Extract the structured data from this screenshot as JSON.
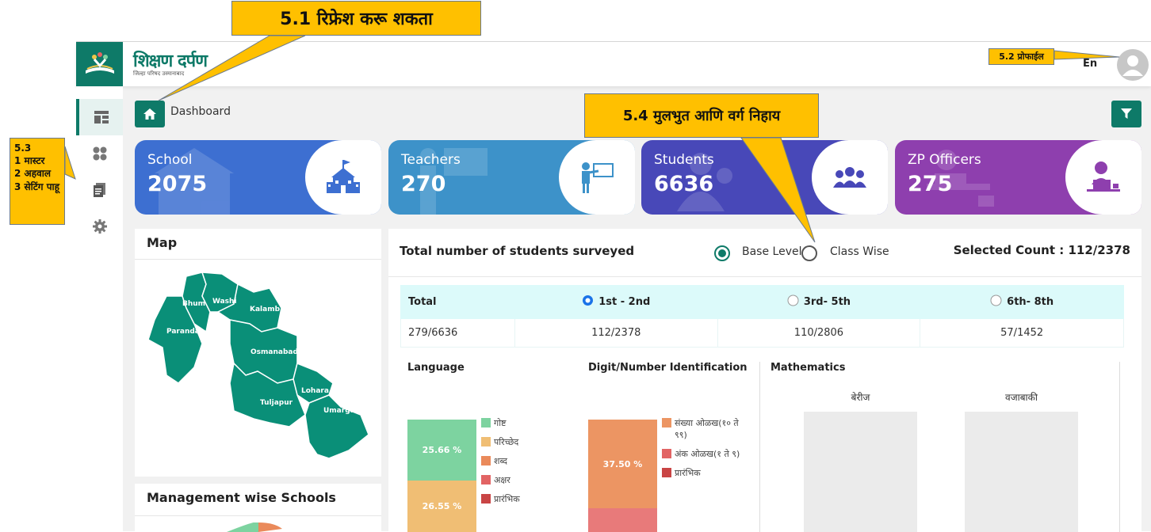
{
  "header": {
    "brand_title": "शिक्षण दर्पण",
    "brand_sub": "जिल्हा परिषद उस्मानाबाद",
    "lang": "En"
  },
  "sidebar": {
    "items": [
      {
        "icon": "dashboard-icon"
      },
      {
        "icon": "apps-icon"
      },
      {
        "icon": "report-icon"
      },
      {
        "icon": "gear-icon"
      }
    ]
  },
  "breadcrumb": {
    "label": "Dashboard"
  },
  "stats": [
    {
      "label": "School",
      "value": "2075",
      "color": "#3d6fd1",
      "icon": "school-icon"
    },
    {
      "label": "Teachers",
      "value": "270",
      "color": "#3d92c9",
      "icon": "teacher-icon"
    },
    {
      "label": "Students",
      "value": "6636",
      "color": "#4848b8",
      "icon": "students-icon"
    },
    {
      "label": "ZP Officers",
      "value": "275",
      "color": "#8e3fae",
      "icon": "officer-icon"
    }
  ],
  "map_card": {
    "title": "Map",
    "regions": [
      "Bhum",
      "Washi",
      "Kalamb",
      "Paranda",
      "Osmanabad",
      "Lohara",
      "Tuljapur",
      "Umarga"
    ]
  },
  "management_card": {
    "title": "Management wise Schools"
  },
  "survey": {
    "title": "Total number of students surveyed",
    "radio_base": "Base Level",
    "radio_class": "Class Wise",
    "selected_count": "Selected Count : 112/2378",
    "table": {
      "headers": [
        "Total",
        "1st - 2nd",
        "3rd- 5th",
        "6th- 8th"
      ],
      "values": [
        "279/6636",
        "112/2378",
        "110/2806",
        "57/1452"
      ]
    },
    "language": {
      "title": "Language",
      "segments": [
        {
          "label": "25.66 %",
          "color": "#7dd3a0"
        },
        {
          "label": "26.55 %",
          "color": "#f0be74"
        }
      ],
      "legend": [
        {
          "label": "गोष्ट",
          "color": "#7dd3a0"
        },
        {
          "label": "परिच्छेद",
          "color": "#f0be74"
        },
        {
          "label": "शब्द",
          "color": "#ea8a5b"
        },
        {
          "label": "अक्षर",
          "color": "#e26464"
        },
        {
          "label": "प्रारंभिक",
          "color": "#c94545"
        }
      ]
    },
    "digit": {
      "title": "Digit/Number Identification",
      "segments": [
        {
          "label": "37.50 %",
          "color": "#ec9563"
        }
      ],
      "legend": [
        {
          "label": "संख्या ओळख(१० ते ९९)",
          "color": "#ec9563"
        },
        {
          "label": "अंक ओळख(१ ते ९)",
          "color": "#e26464"
        },
        {
          "label": "प्रारंभिक",
          "color": "#c94545"
        }
      ]
    },
    "math": {
      "title": "Mathematics",
      "cols": [
        "बेरीज",
        "वजाबाकी"
      ]
    }
  },
  "callouts": {
    "refresh": "5.1 रिफ्रेश करू शकता",
    "profile": "5.2 प्रोफाईल",
    "menu": "5.3\n1 मास्टर\n2 अहवाल\n3 सेटिंग पाहू",
    "base_class": "5.4 मुलभुत आणि वर्ग निहाय"
  }
}
